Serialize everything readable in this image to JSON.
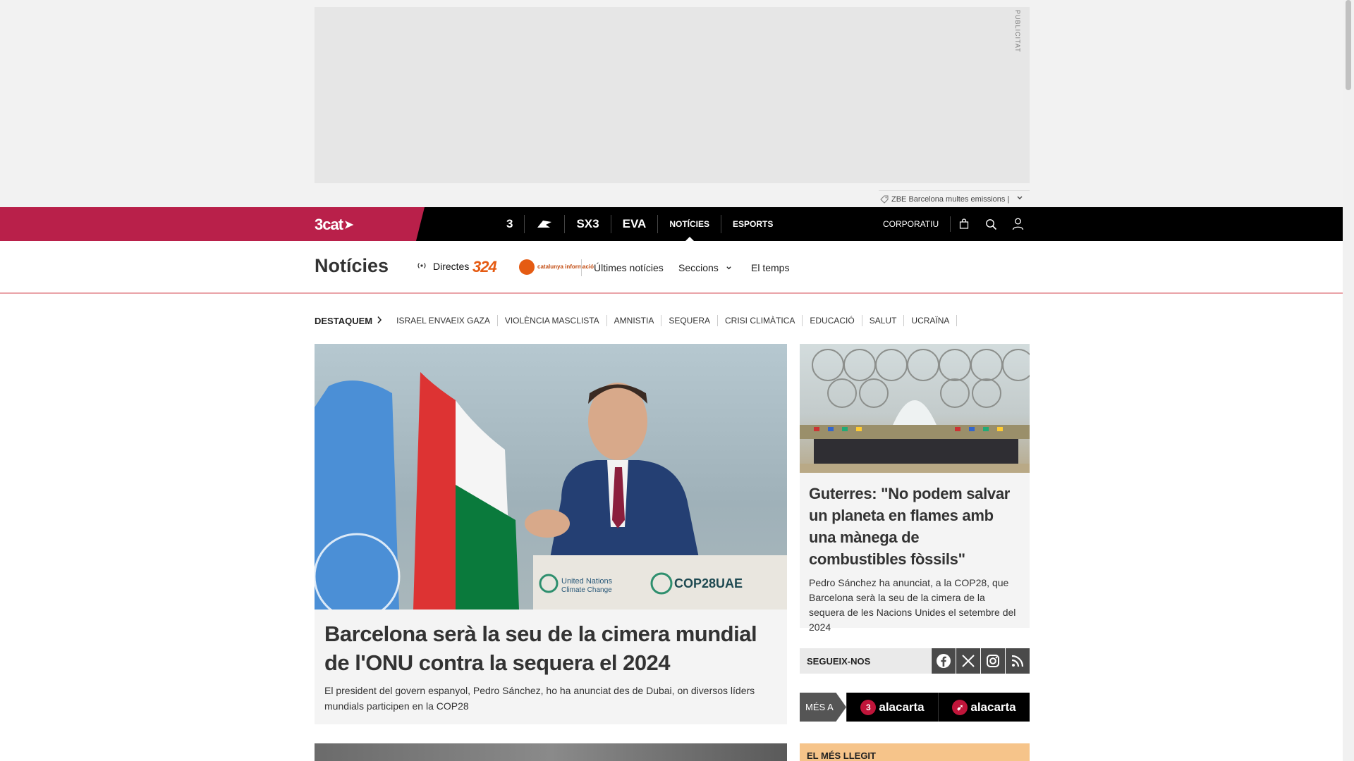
{
  "ad": {
    "label": "PUBLICITAT"
  },
  "ticker": {
    "text": "ZBE Barcelona multes emissions |"
  },
  "topbar": {
    "brand": "3cat",
    "channels": [
      {
        "label": "3",
        "icon": "tv3-icon"
      },
      {
        "label": "Cat Ràdio",
        "icon": "catradio-icon"
      },
      {
        "label": "SX3",
        "icon": "sx3-icon"
      },
      {
        "label": "EVA",
        "icon": "eva-icon"
      }
    ],
    "nav": [
      {
        "label": "NOTÍCIES",
        "active": true
      },
      {
        "label": "ESPORTS",
        "active": false
      }
    ],
    "corporate": "CORPORATIU"
  },
  "section": {
    "title": "Notícies",
    "live_label": "Directes",
    "channel_324": "324",
    "cat_info": "catalunya informació",
    "links": [
      "Últimes notícies",
      "Seccions",
      "El temps"
    ]
  },
  "highlights": {
    "title": "DESTAQUEM",
    "items": [
      "ISRAEL ENVAEIX GAZA",
      "VIOLÈNCIA MASCLISTA",
      "AMNISTIA",
      "SEQUERA",
      "CRISI CLIMÀTICA",
      "EDUCACIÓ",
      "SALUT",
      "UCRAÏNA"
    ]
  },
  "main_story": {
    "title": "Barcelona serà la seu de la cimera mundial de l'ONU contra la sequera el 2024",
    "summary": "El president del govern espanyol, Pedro Sánchez, ho ha anunciat des de Dubai, on diversos líders mundials participen en la COP28",
    "image_caption_un": "United Nations",
    "image_caption_un2": "Climate Change",
    "image_caption_cop": "COP28UAE"
  },
  "side_story": {
    "title": "Guterres: \"No podem salvar un planeta en flames amb una mànega de combustibles fòssils\"",
    "summary": "Pedro Sánchez ha anunciat, a la COP28, que Barcelona serà la seu de la cimera de la sequera de les Nacions Unides el setembre del 2024"
  },
  "follow": {
    "label": "SEGUEIX-NOS",
    "networks": [
      "facebook-icon",
      "x-icon",
      "instagram-icon",
      "rss-icon"
    ]
  },
  "more_at": {
    "label": "MÉS A",
    "logos": [
      {
        "prefix": "3",
        "text": "alacarta"
      },
      {
        "prefix": "➹",
        "text": "alacarta"
      }
    ]
  },
  "most_read": {
    "title": "EL MÉS LLEGIT"
  },
  "colors": {
    "brand": "#b9204a",
    "accent_324": "#e55b13",
    "most_read": "#f6c48a"
  }
}
